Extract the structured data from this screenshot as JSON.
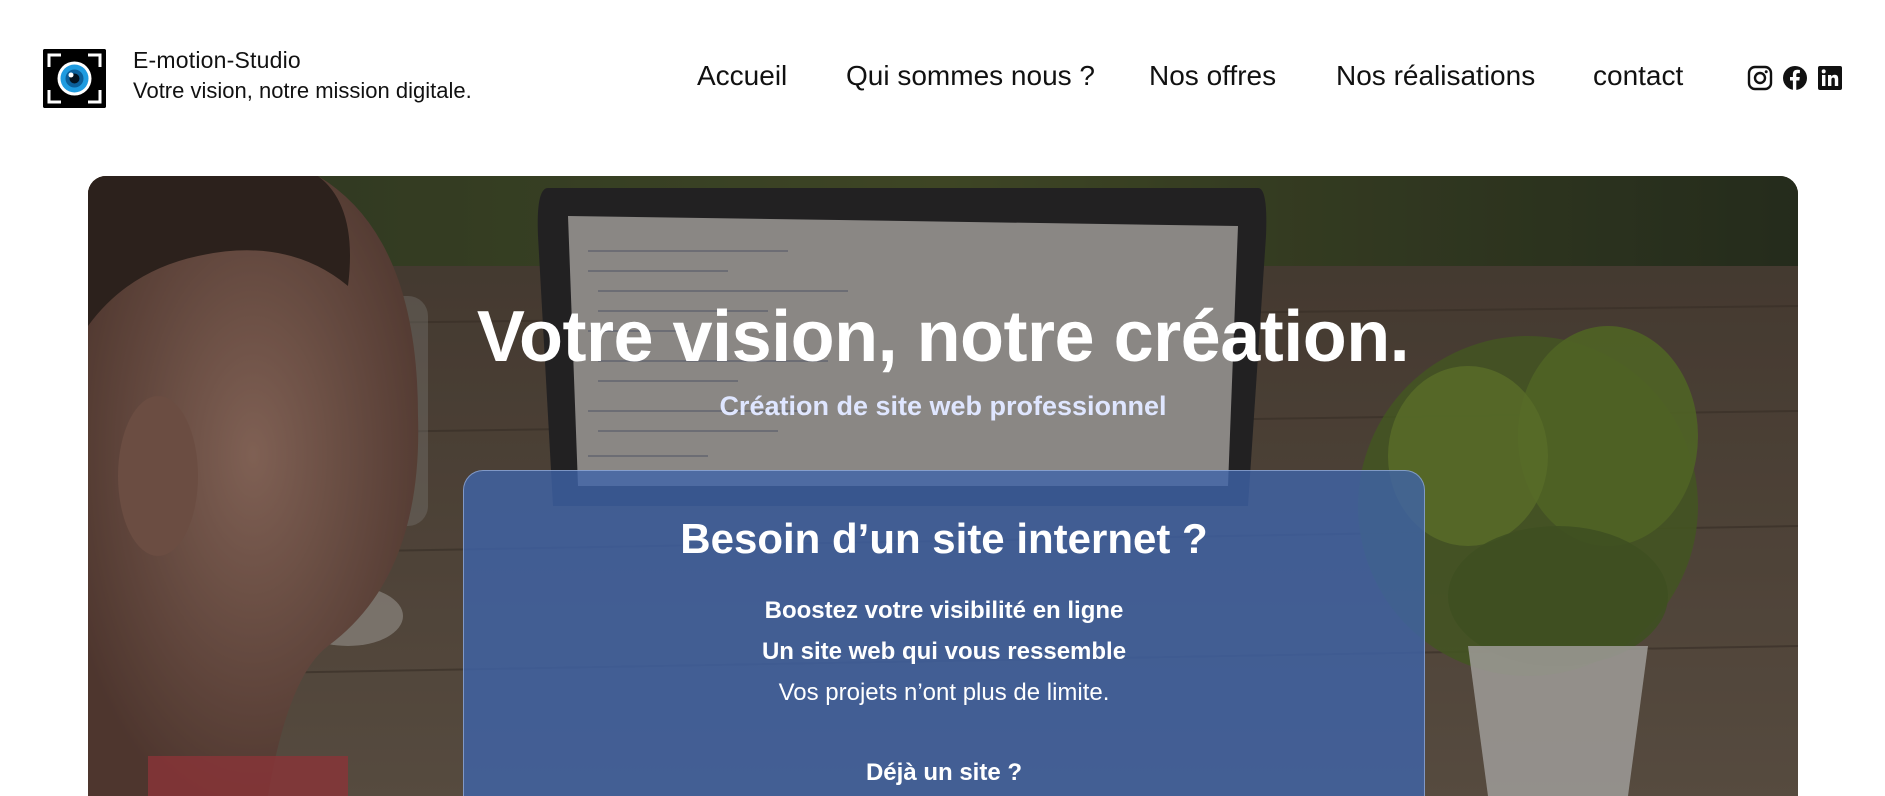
{
  "header": {
    "logo_icon": "eye-camera-logo-icon",
    "brand_name": "E-motion-Studio",
    "brand_tagline": "Votre vision, notre mission digitale.",
    "nav": [
      {
        "label": "Accueil"
      },
      {
        "label": "Qui sommes nous ?"
      },
      {
        "label": "Nos offres"
      },
      {
        "label": "Nos réalisations"
      },
      {
        "label": "contact"
      }
    ],
    "social": [
      {
        "icon": "instagram-icon"
      },
      {
        "icon": "facebook-icon"
      },
      {
        "icon": "linkedin-icon"
      }
    ]
  },
  "hero": {
    "title": "Votre vision, notre création.",
    "subtitle": "Création de site web professionnel",
    "card": {
      "title": "Besoin d’un site internet ?",
      "line1": "Boostez votre visibilité en ligne",
      "line2": "Un site web qui vous ressemble",
      "line3": "Vos projets n’ont plus de limite.",
      "line4": "Déjà un site ?"
    }
  },
  "colors": {
    "card_background": "#3e64aa",
    "subtitle": "#dfe6ff",
    "logo_eye": "#1e9be0"
  }
}
